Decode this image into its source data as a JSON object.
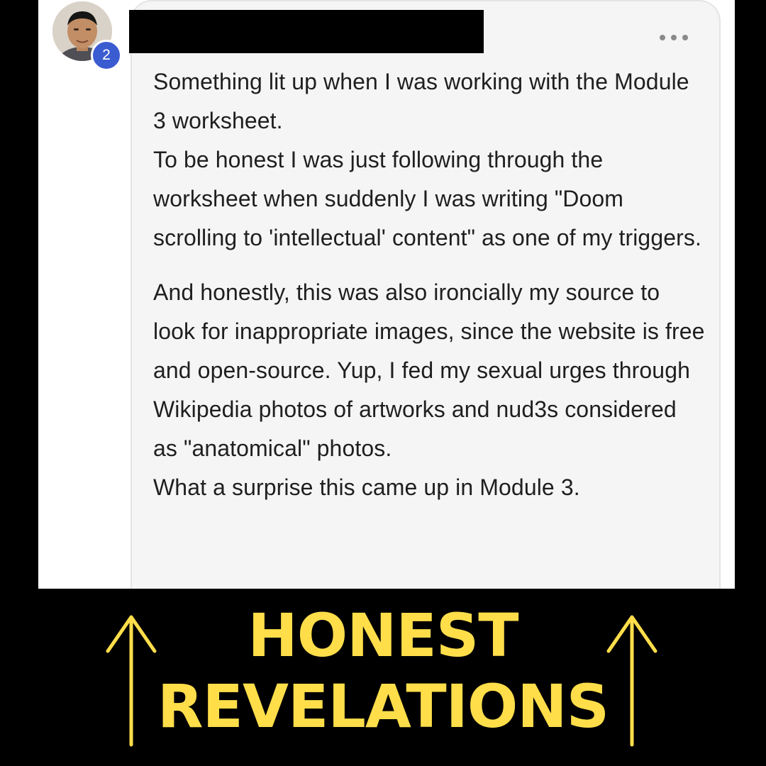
{
  "post": {
    "badge_count": "2",
    "paragraphs": [
      "Something lit up when I was working with the Module 3 worksheet.",
      "To be honest I was just following through the worksheet when suddenly I was writing \"Doom scrolling to 'intellectual' content\" as one of my triggers.",
      "",
      "And honestly, this was also ironcially my source to look for inappropriate images, since the website is free and open-source. Yup, I fed my sexual urges through Wikipedia photos of artworks and nud3s considered as \"anatomical\" photos.",
      "What a surprise this came up in Module 3."
    ]
  },
  "caption": {
    "line1": "HONEST",
    "line2": "REVELATIONS"
  },
  "colors": {
    "caption": "#ffde4a",
    "badge": "#3b5bd0",
    "bubble": "#f5f5f5",
    "background": "#000000"
  },
  "icons": {
    "more": "more-options-icon",
    "arrow": "up-arrow-icon"
  }
}
